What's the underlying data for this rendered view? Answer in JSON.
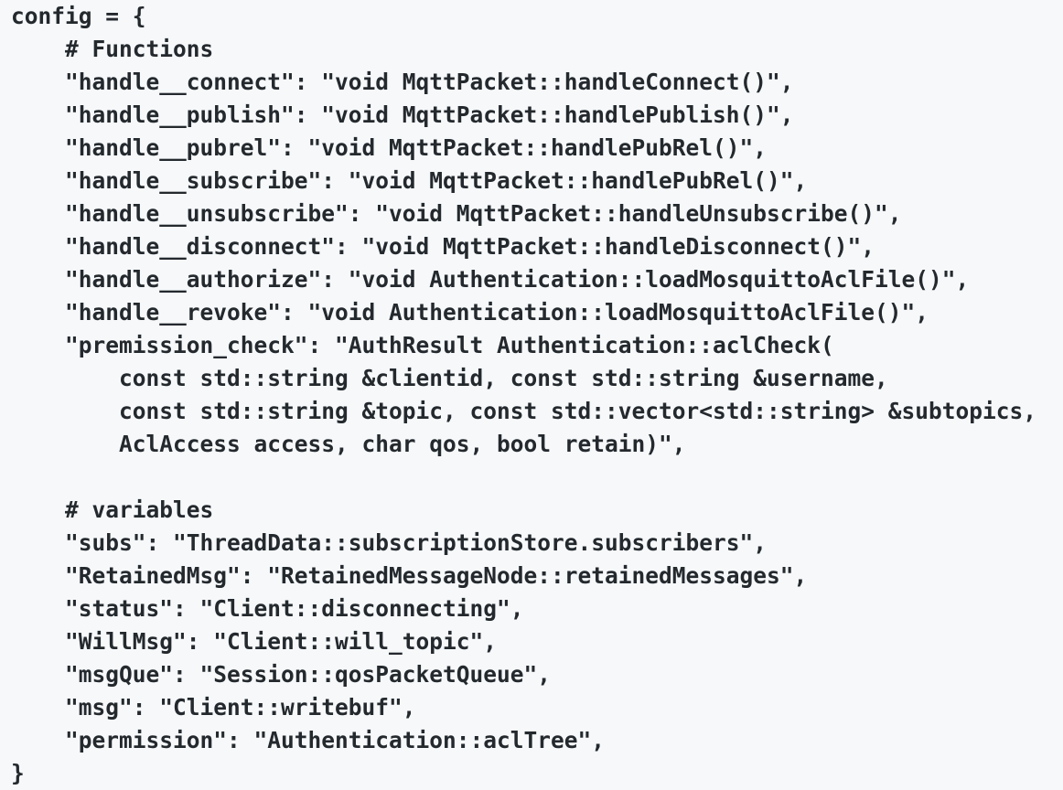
{
  "code": {
    "lines": [
      "config = {",
      "    # Functions",
      "    \"handle__connect\": \"void MqttPacket::handleConnect()\",",
      "    \"handle__publish\": \"void MqttPacket::handlePublish()\",",
      "    \"handle__pubrel\": \"void MqttPacket::handlePubRel()\",",
      "    \"handle__subscribe\": \"void MqttPacket::handlePubRel()\",",
      "    \"handle__unsubscribe\": \"void MqttPacket::handleUnsubscribe()\",",
      "    \"handle__disconnect\": \"void MqttPacket::handleDisconnect()\",",
      "    \"handle__authorize\": \"void Authentication::loadMosquittoAclFile()\",",
      "    \"handle__revoke\": \"void Authentication::loadMosquittoAclFile()\",",
      "    \"premission_check\": \"AuthResult Authentication::aclCheck(",
      "        const std::string &clientid, const std::string &username,",
      "        const std::string &topic, const std::vector<std::string> &subtopics,",
      "        AclAccess access, char qos, bool retain)\",",
      "",
      "    # variables",
      "    \"subs\": \"ThreadData::subscriptionStore.subscribers\",",
      "    \"RetainedMsg\": \"RetainedMessageNode::retainedMessages\",",
      "    \"status\": \"Client::disconnecting\",",
      "    \"WillMsg\": \"Client::will_topic\",",
      "    \"msgQue\": \"Session::qosPacketQueue\",",
      "    \"msg\": \"Client::writebuf\",",
      "    \"permission\": \"Authentication::aclTree\",",
      "}"
    ]
  }
}
